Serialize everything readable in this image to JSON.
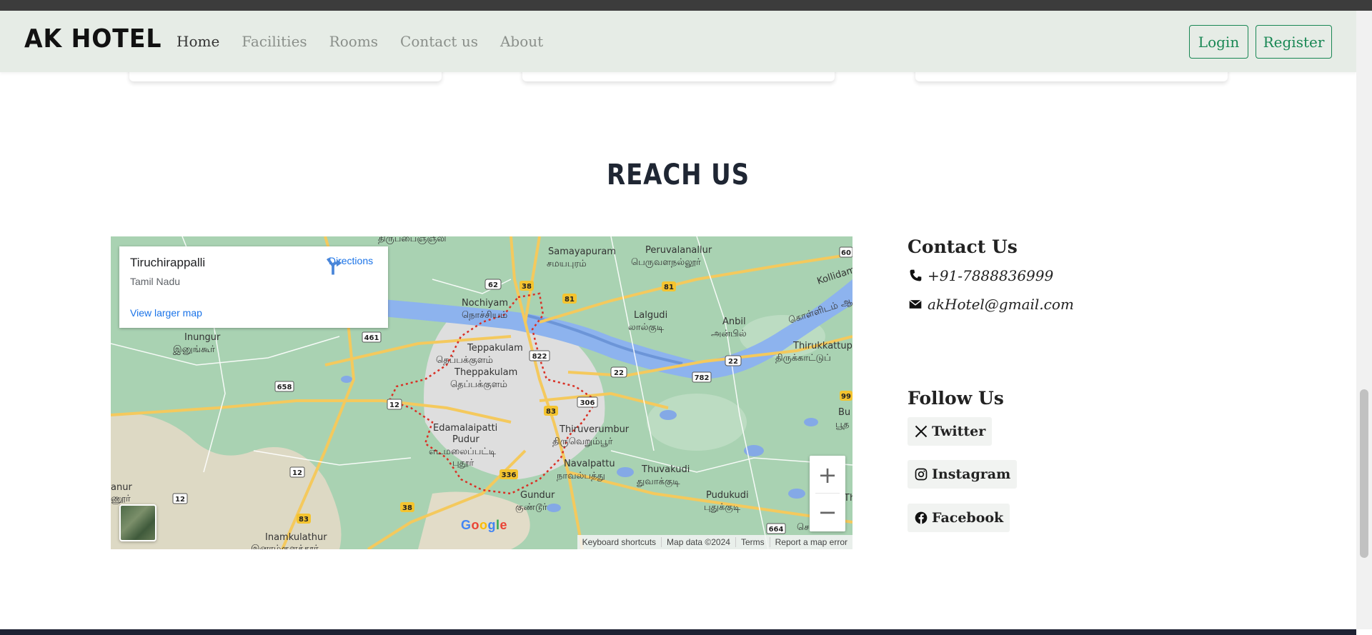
{
  "navbar": {
    "brand": "AK HOTEL",
    "links": [
      "Home",
      "Facilities",
      "Rooms",
      "Contact us",
      "About"
    ],
    "active": "Home",
    "login_label": "Login",
    "register_label": "Register",
    "accent_color": "#198754"
  },
  "reach": {
    "title": "REACH US"
  },
  "map": {
    "place_name": "Tiruchirappalli",
    "place_region": "Tamil Nadu",
    "directions_label": "Directions",
    "larger_map_label": "View larger map",
    "zoom_in": "+",
    "zoom_out": "−",
    "logo": "Google",
    "footer": [
      "Keyboard shortcuts",
      "Map data ©2024",
      "Terms",
      "Report a map error"
    ],
    "labels": {
      "tiruppai": "திருப்பைஞ்ஞீலி",
      "samayapuram": "Samayapuram",
      "samayapuram_ta": "சமயபுரம்",
      "peruvalanallur": "Peruvalanallur",
      "peruvalanallur_ta": "பெருவளநல்லூர்",
      "nochiyam": "Nochiyam",
      "nochiyam_ta": "நொச்சியம்",
      "lalgudi": "Lalgudi",
      "lalgudi_ta": "லால்குடி",
      "anbil": "Anbil",
      "anbil_ta": "அன்பில்",
      "inungur": "Inungur",
      "inungur_ta": "இனுங்கூர்",
      "teppakulam": "Teppakulam",
      "teppakulam_ta": "தெப்பக்குளம்",
      "theppakulam": "Theppakulam",
      "theppakulam_ta": "தெப்பக்குளம்",
      "thirukkattu": "Thirukkattupa",
      "thirukkattu_ta": "திருக்காட்டுப்",
      "edamalaipatti": "Edamalaipatti",
      "pudur": "Pudur",
      "edamalaipatti_ta": "எடமலைப்பட்டி",
      "pudur_ta": "புதூர்",
      "thiruverumbur": "Thiruverumbur",
      "thiruverumbur_ta": "திருவெறும்பூர்",
      "navalpattu": "Navalpattu",
      "navalpattu_ta": "நாவல்பத்து",
      "thuvakudi": "Thuvakudi",
      "thuvakudi_ta": "துவாக்குடி",
      "gundur": "Gundur",
      "gundur_ta": "குண்டூர்",
      "pudukudi": "Pudukudi",
      "pudukudi_ta": "புதுக்குடி",
      "inamkulathur": "Inamkulathur",
      "inamkulathur_ta": "இனாம்குளத்தூர்",
      "kollidam": "Kollidam",
      "kollidam_ta": "கொள்ளிடம் ஆ",
      "anur": "anur",
      "anur_ta": "ணூர்",
      "bu": "Bu",
      "bu_ta": "பூத",
      "th": "Th",
      "sengipatti_ta": "செங்கிப்"
    },
    "shields": [
      "62",
      "38",
      "81",
      "81",
      "461",
      "822",
      "22",
      "782",
      "22",
      "658",
      "12",
      "83",
      "306",
      "12",
      "336",
      "12",
      "38",
      "83",
      "664",
      "99",
      "60"
    ]
  },
  "contact": {
    "title": "Contact Us",
    "phone": "+91-7888836999",
    "email": "akHotel@gmail.com"
  },
  "follow": {
    "title": "Follow Us",
    "twitter": "Twitter",
    "instagram": "Instagram",
    "facebook": "Facebook"
  }
}
